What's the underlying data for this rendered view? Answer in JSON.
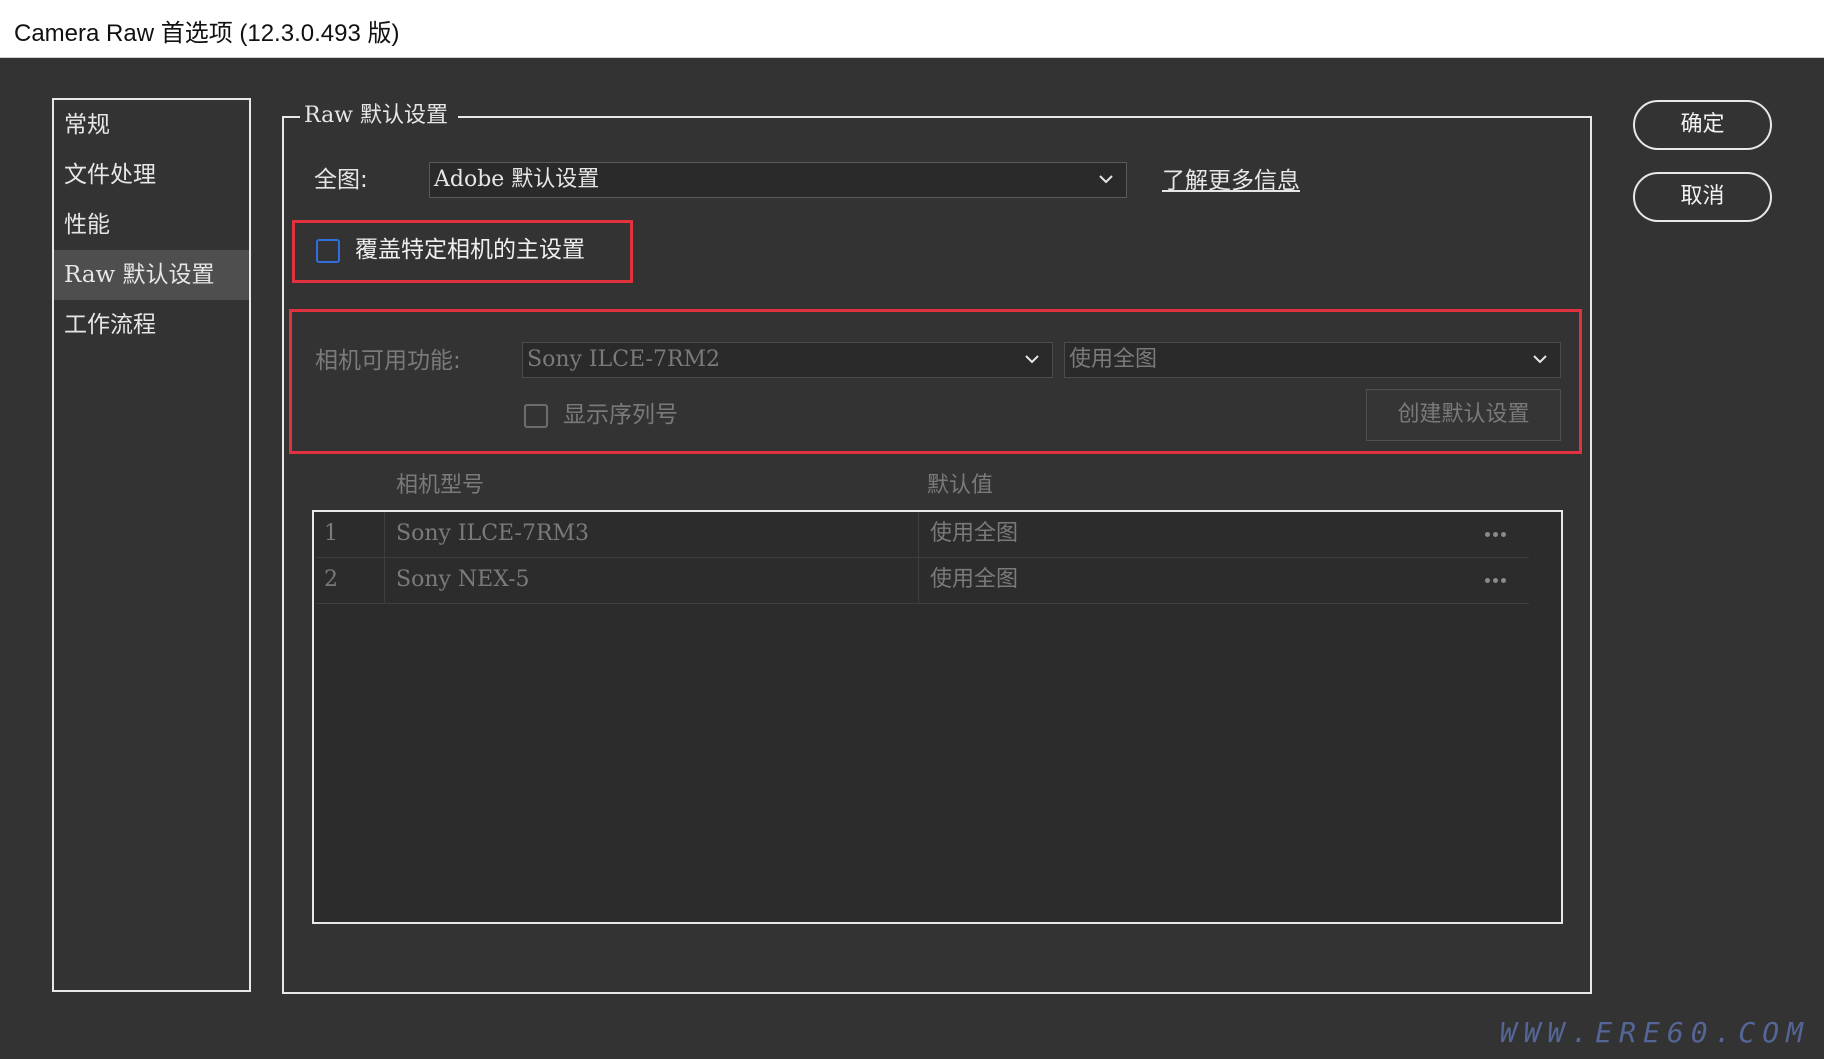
{
  "window": {
    "title": "Camera Raw 首选项 (12.3.0.493 版)"
  },
  "nav": {
    "items": [
      {
        "label": "常规"
      },
      {
        "label": "文件处理"
      },
      {
        "label": "性能"
      },
      {
        "label": "Raw 默认设置",
        "selected": true
      },
      {
        "label": "工作流程"
      }
    ]
  },
  "raw_defaults": {
    "group_title": "Raw 默认设置",
    "global_label": "全图:",
    "global_value": "Adobe 默认设置",
    "learn_more": "了解更多信息",
    "override_checkbox": {
      "label": "覆盖特定相机的主设置",
      "checked": false
    },
    "camera": {
      "label": "相机可用功能:",
      "model_value": "Sony ILCE-7RM2",
      "default_value": "使用全图",
      "show_serial_label": "显示序列号",
      "show_serial_checked": false,
      "create_button": "创建默认设置"
    },
    "table": {
      "headers": [
        "相机型号",
        "默认值"
      ],
      "rows": [
        {
          "index": "1",
          "model": "Sony ILCE-7RM3",
          "value": "使用全图"
        },
        {
          "index": "2",
          "model": "Sony NEX-5",
          "value": "使用全图"
        }
      ]
    }
  },
  "buttons": {
    "ok": "确定",
    "cancel": "取消"
  },
  "watermark": "WWW.ERE60.COM",
  "colors": {
    "highlight_red": "#e2323e",
    "checkbox_blue": "#2f6fdc",
    "background": "#333333"
  }
}
